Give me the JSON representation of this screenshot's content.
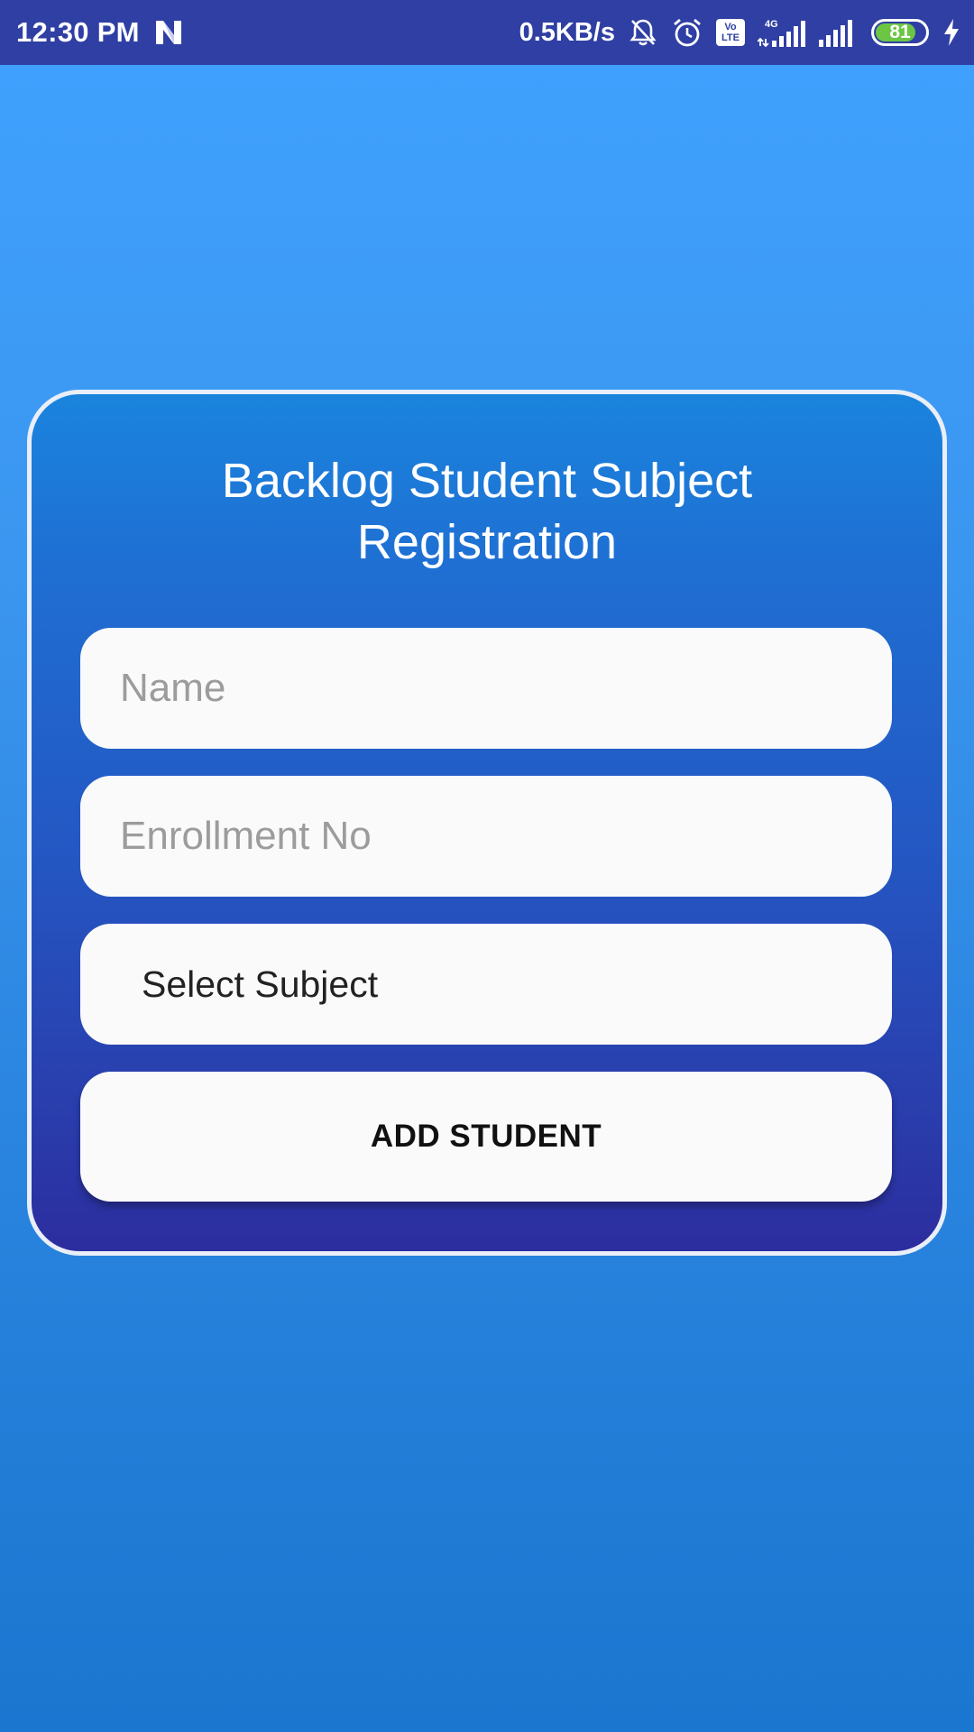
{
  "status_bar": {
    "time": "12:30 PM",
    "network_speed": "0.5KB/s",
    "battery_level": "81",
    "battery_fraction": 0.81,
    "network_type": "4G",
    "icons": [
      "n-logo-icon",
      "muted-bell-icon",
      "alarm-icon",
      "volte-icon",
      "signal-4g-icon",
      "signal-icon",
      "battery-icon",
      "charging-icon"
    ]
  },
  "form": {
    "title": "Backlog Student Subject Registration",
    "name_placeholder": "Name",
    "name_value": "",
    "enrollment_placeholder": "Enrollment No",
    "enrollment_value": "",
    "subject_select_value": "Select Subject",
    "submit_label": "ADD STUDENT"
  },
  "colors": {
    "status_bar": "#2f3fa3",
    "background_top": "#40a2ff",
    "background_bottom": "#1a76cf",
    "card_top": "#1a84dd",
    "card_bottom": "#2c2d9e",
    "field_background": "#fafafa",
    "battery_fill": "#6cc644"
  }
}
